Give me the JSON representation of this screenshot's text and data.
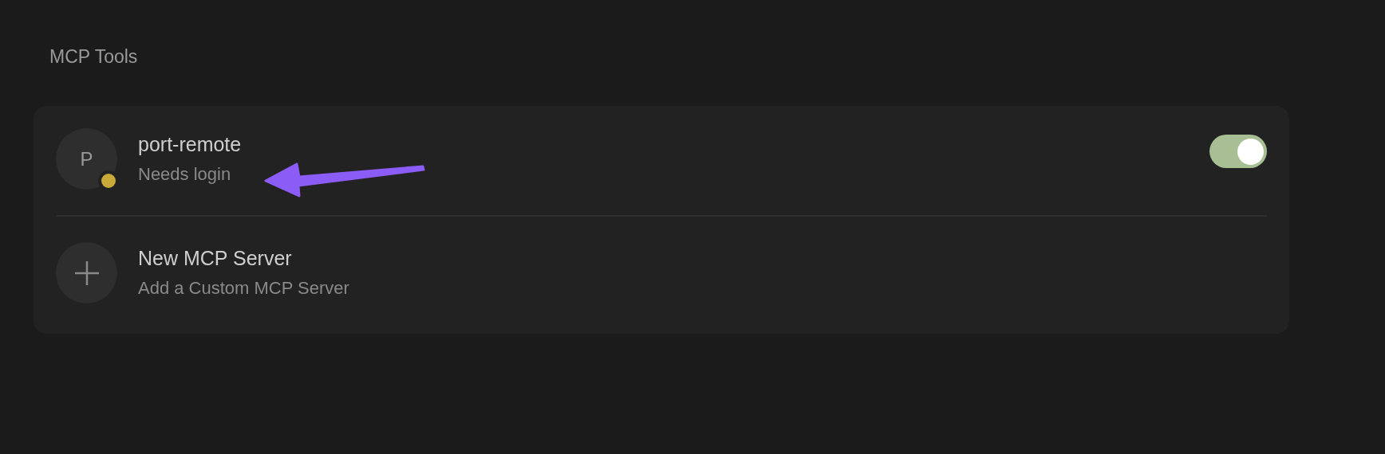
{
  "section_title": "MCP Tools",
  "items": [
    {
      "kind": "server",
      "initial": "P",
      "name": "port-remote",
      "status": "Needs login",
      "color": "#c9a93a",
      "enabled": true
    },
    {
      "kind": "add",
      "name": "New MCP Server",
      "status": "Add a Custom MCP Server"
    }
  ]
}
